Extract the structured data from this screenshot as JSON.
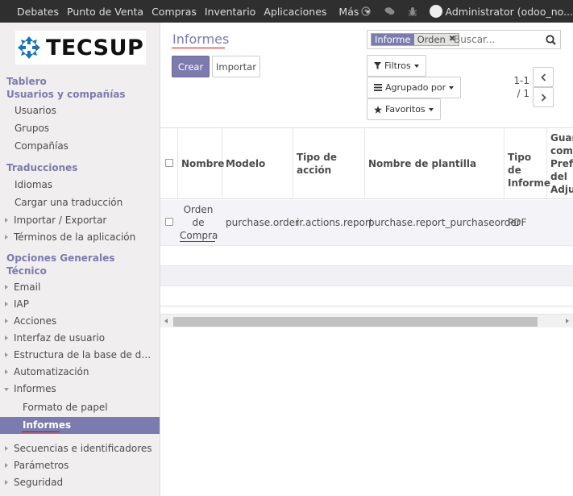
{
  "navbar": {
    "menu": [
      "Debates",
      "Punto de Venta",
      "Compras",
      "Inventario",
      "Aplicaciones",
      "Más"
    ],
    "user_label": "Administrator (odoo_no..."
  },
  "sidebar": {
    "logo_text": "TECSUP",
    "sections": [
      {
        "title": "Tablero"
      },
      {
        "title": "Usuarios y compañías",
        "items": [
          "Usuarios",
          "Grupos",
          "Compañías"
        ]
      },
      {
        "title": "Traducciones",
        "items": [
          "Idiomas",
          "Cargar una traducción",
          "Importar / Exportar",
          "Términos de la aplicación"
        ]
      },
      {
        "title": "Opciones Generales"
      },
      {
        "title": "Técnico",
        "items": [
          "Email",
          "IAP",
          "Acciones",
          "Interfaz de usuario",
          "Estructura de la base de d…",
          "Automatización",
          "Informes",
          "Formato de papel",
          "Informes",
          "Secuencias e identificadores",
          "Parámetros",
          "Seguridad"
        ]
      }
    ]
  },
  "control_panel": {
    "title": "Informes",
    "create_label": "Crear",
    "import_label": "Importar",
    "search": {
      "facet_category": "Informe",
      "facet_value": "Orden",
      "placeholder": "Buscar..."
    },
    "filters_label": "Filtros",
    "group_by_label": "Agrupado por",
    "favorites_label": "Favoritos",
    "pager": {
      "range": "1-1",
      "total": "/ 1"
    }
  },
  "table": {
    "columns": [
      "Nombre",
      "Modelo",
      "Tipo de acción",
      "Nombre de plantilla",
      "Tipo de Informe",
      "Guardar como Prefijo del Adjunto"
    ],
    "rows": [
      {
        "name": "Orden de Compra",
        "model": "purchase.order",
        "action_type": "ir.actions.report",
        "template": "purchase.report_purchaseorder",
        "report_type": "PDF",
        "attachment": ""
      }
    ]
  },
  "colors": {
    "accent": "#7c7bad",
    "navbar": "#2f2f2f",
    "annotation": "#e00000"
  }
}
